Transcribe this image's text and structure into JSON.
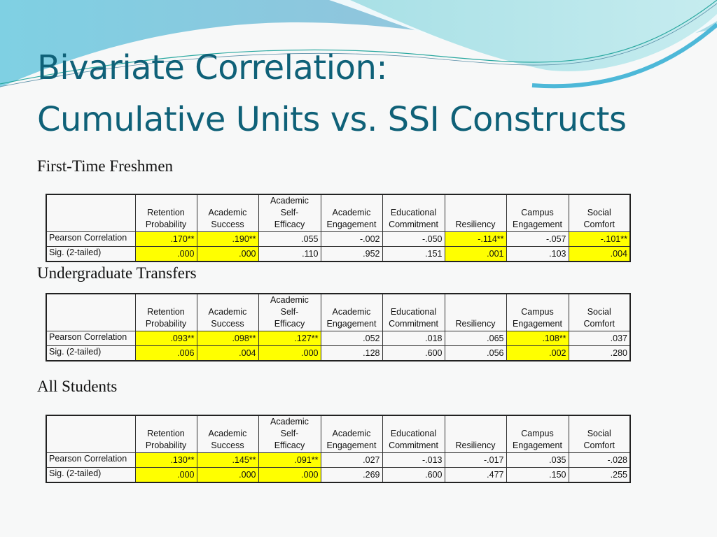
{
  "slide": {
    "title_line1": "Bivariate Correlation:",
    "title_line2": "Cumulative Units vs. SSI Constructs",
    "highlight_color": "#ffff00",
    "title_color": "#0f6178"
  },
  "columns": [
    "Retention Probability",
    "Academic Success",
    "Academic Self-Efficacy",
    "Academic Engagement",
    "Educational Commitment",
    "Resiliency",
    "Campus Engagement",
    "Social Comfort"
  ],
  "column_header_lines": [
    [
      "Retention",
      "Probability"
    ],
    [
      "Academic",
      "Success"
    ],
    [
      "Academic Self-",
      "Efficacy"
    ],
    [
      "Academic",
      "Engagement"
    ],
    [
      "Educational",
      "Commitment"
    ],
    [
      "",
      "Resiliency"
    ],
    [
      "Campus",
      "Engagement"
    ],
    [
      "",
      "Social Comfort"
    ]
  ],
  "row_labels": [
    "Pearson Correlation",
    "Sig. (2-tailed)"
  ],
  "tables": [
    {
      "label": "First-Time Freshmen",
      "pearson": [
        ".170**",
        ".190**",
        ".055",
        "-.002",
        "-.050",
        "-.114**",
        "-.057",
        "-.101**"
      ],
      "sig": [
        ".000",
        ".000",
        ".110",
        ".952",
        ".151",
        ".001",
        ".103",
        ".004"
      ],
      "highlighted": [
        true,
        true,
        false,
        false,
        false,
        true,
        false,
        true
      ]
    },
    {
      "label": "Undergraduate Transfers",
      "pearson": [
        ".093**",
        ".098**",
        ".127**",
        ".052",
        ".018",
        ".065",
        ".108**",
        ".037"
      ],
      "sig": [
        ".006",
        ".004",
        ".000",
        ".128",
        ".600",
        ".056",
        ".002",
        ".280"
      ],
      "highlighted": [
        true,
        true,
        true,
        false,
        false,
        false,
        true,
        false
      ]
    },
    {
      "label": "All Students",
      "pearson": [
        ".130**",
        ".145**",
        ".091**",
        ".027",
        "-.013",
        "-.017",
        ".035",
        "-.028"
      ],
      "sig": [
        ".000",
        ".000",
        ".000",
        ".269",
        ".600",
        ".477",
        ".150",
        ".255"
      ],
      "highlighted": [
        true,
        true,
        true,
        false,
        false,
        false,
        false,
        false
      ]
    }
  ]
}
